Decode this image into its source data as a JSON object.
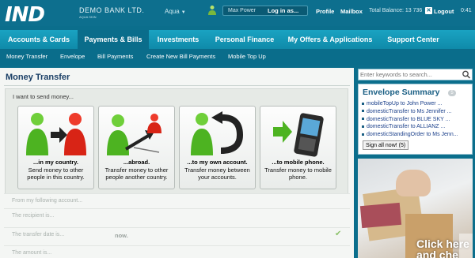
{
  "header": {
    "logo": "IND",
    "bank_name": "DEMO BANK LTD.",
    "bank_sub": "AQUA SKIN",
    "theme": "Aqua",
    "username_placeholder": "Max Power",
    "login_label": "Log in as...",
    "profile_label": "Profile",
    "mailbox_label": "Mailbox",
    "balance": "Total Balance: 13 736",
    "logout_label": "Logout",
    "clock": "0:41"
  },
  "main_nav": {
    "tabs": [
      {
        "label": "Accounts & Cards"
      },
      {
        "label": "Payments & Bills"
      },
      {
        "label": "Investments"
      },
      {
        "label": "Personal Finance"
      },
      {
        "label": "My Offers & Applications"
      },
      {
        "label": "Support Center"
      }
    ],
    "active": "Payments & Bills"
  },
  "sub_nav": {
    "items": [
      {
        "label": "Money Transfer"
      },
      {
        "label": "Envelope"
      },
      {
        "label": "Bill Payments"
      },
      {
        "label": "Create New Bill Payments"
      },
      {
        "label": "Mobile Top Up"
      }
    ]
  },
  "money_transfer": {
    "title": "Money Transfer",
    "question": "I want to send money...",
    "options": [
      {
        "title": "...in my country.",
        "desc": "Send money to other people in this country.",
        "icon": "domestic-transfer-icon"
      },
      {
        "title": "...abroad.",
        "desc": "Transfer money to other people another country.",
        "icon": "foreign-transfer-icon"
      },
      {
        "title": "...to my own account.",
        "desc": "Transfer money between your accounts.",
        "icon": "own-account-transfer-icon"
      },
      {
        "title": "...to mobile phone.",
        "desc": "Transfer money to mobile phone.",
        "icon": "mobile-transfer-icon"
      }
    ],
    "form": {
      "from": "From my following account...",
      "recipient": "The recipient is...",
      "date": "The transfer date is...",
      "date_value": "now.",
      "amount": "The amount is..."
    }
  },
  "sidebar": {
    "search_placeholder": "Enter keywords to search...",
    "envelope": {
      "title": "Envelope Summary",
      "count": "5",
      "items": [
        "mobileTopUp to John Power ...",
        "domesticTransfer to Ms Jennifer ...",
        "domesticTransfer to BLUE SKY ...",
        "domesticTransfer to ALLIANZ ...",
        "domesticStandingOrder to Ms Jenn..."
      ],
      "sign_all": "Sign all now! (5)"
    },
    "promo": {
      "line1": "Click here",
      "line2": "and che"
    }
  },
  "colors": {
    "brand": "#0d6f8e",
    "nav": "#1aa3c2",
    "active_tab": "#0a6d8b",
    "title": "#1a3f66",
    "link": "#1a3f8a"
  }
}
